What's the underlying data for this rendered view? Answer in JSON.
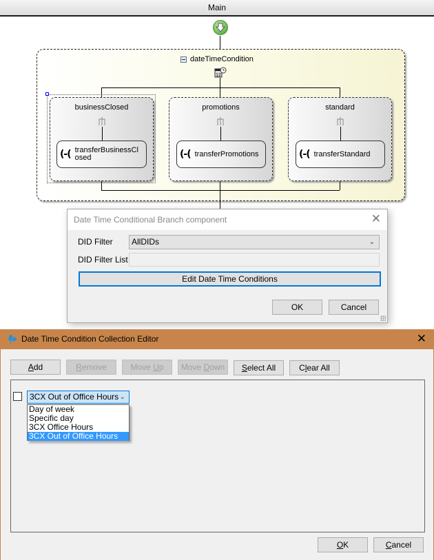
{
  "designer": {
    "header_title": "Main",
    "condition": {
      "title": "dateTimeCondition",
      "branches": [
        {
          "name": "businessClosed",
          "action": "transferBusinessCl\nosed",
          "selected": true
        },
        {
          "name": "promotions",
          "action": "transferPromotions",
          "selected": false
        },
        {
          "name": "standard",
          "action": "transferStandard",
          "selected": false
        }
      ]
    }
  },
  "branch_dialog": {
    "title": "Date Time Conditional Branch component",
    "close_glyph": "✕",
    "did_filter_label": "DID Filter",
    "did_filter_value": "AllDIDs",
    "did_filter_list_label": "DID Filter List",
    "did_filter_list_value": "",
    "edit_button": "Edit Date Time Conditions",
    "ok": "OK",
    "cancel": "Cancel"
  },
  "collection_editor": {
    "title": "Date Time Condition Collection Editor",
    "close_glyph": "✕",
    "toolbar": {
      "add": {
        "accel": "A",
        "rest": "dd",
        "enabled": true
      },
      "remove": {
        "accel": "R",
        "rest": "emove",
        "enabled": false
      },
      "move_up": {
        "pre": "Move ",
        "accel": "U",
        "rest": "p",
        "enabled": false
      },
      "move_down": {
        "pre": "Move ",
        "accel": "D",
        "rest": "own",
        "enabled": false
      },
      "select_all": {
        "accel": "S",
        "rest": "elect All",
        "enabled": true
      },
      "clear_all": {
        "pre": "C",
        "accel": "l",
        "rest": "ear All",
        "enabled": true
      }
    },
    "row": {
      "checked": false,
      "combo_value": "3CX Out of Office Hours",
      "options": [
        "Day of week",
        "Specific day",
        "3CX Office Hours",
        "3CX Out of Office Hours"
      ],
      "selected_option": "3CX Out of Office Hours"
    },
    "ok": {
      "accel": "O",
      "rest": "K"
    },
    "cancel": {
      "accel": "C",
      "rest": "ancel"
    }
  }
}
